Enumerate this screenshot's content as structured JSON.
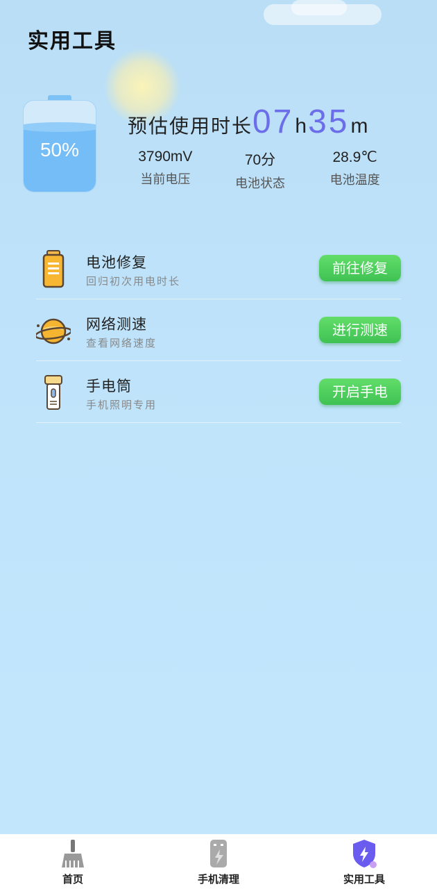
{
  "page": {
    "title": "实用工具"
  },
  "battery": {
    "level_percent": 50,
    "level_text": "50%",
    "estimate_label": "预估使用时长",
    "hours": "07",
    "hours_unit": "h",
    "minutes": "35",
    "minutes_unit": "m",
    "stats": [
      {
        "value": "3790mV",
        "label": "当前电压"
      },
      {
        "value": "70分",
        "label": "电池状态"
      },
      {
        "value": "28.9℃",
        "label": "电池温度"
      }
    ]
  },
  "tools": [
    {
      "name": "电池修复",
      "desc": "回归初次用电时长",
      "button": "前往修复",
      "icon": "battery-repair-icon"
    },
    {
      "name": "网络测速",
      "desc": "查看网络速度",
      "button": "进行测速",
      "icon": "planet-icon"
    },
    {
      "name": "手电筒",
      "desc": "手机照明专用",
      "button": "开启手电",
      "icon": "flashlight-icon"
    }
  ],
  "tabbar": {
    "tabs": [
      {
        "label": "首页",
        "icon": "broom-icon"
      },
      {
        "label": "手机清理",
        "icon": "phone-clean-icon"
      },
      {
        "label": "实用工具",
        "icon": "shield-bolt-icon",
        "active": true
      }
    ]
  },
  "colors": {
    "accent": "#6b6ee8",
    "button_green": "#4bcb5c",
    "battery_blue": "#75bdf6"
  }
}
